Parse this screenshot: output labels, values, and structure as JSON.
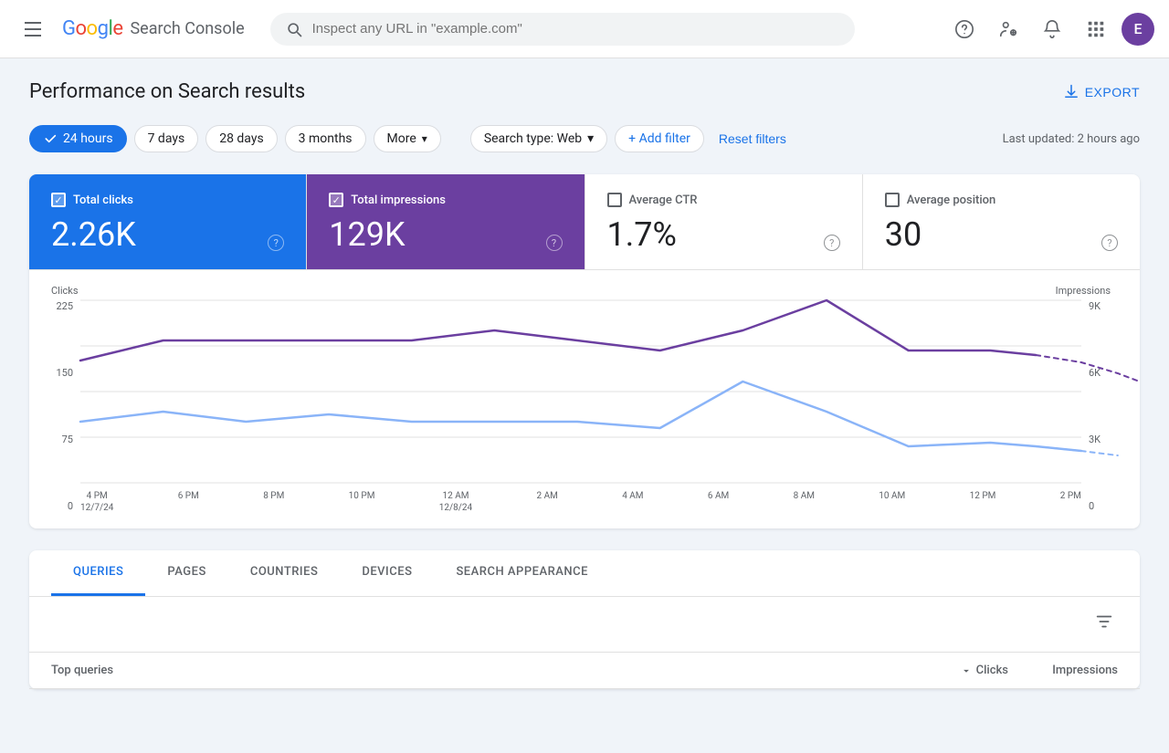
{
  "header": {
    "hamburger_label": "Menu",
    "logo_google": "Google",
    "logo_letters": [
      {
        "letter": "G",
        "color_class": "g-blue"
      },
      {
        "letter": "o",
        "color_class": "g-red"
      },
      {
        "letter": "o",
        "color_class": "g-yellow"
      },
      {
        "letter": "g",
        "color_class": "g-blue"
      },
      {
        "letter": "l",
        "color_class": "g-green"
      },
      {
        "letter": "e",
        "color_class": "g-red"
      }
    ],
    "product_name": "Search Console",
    "search_placeholder": "Inspect any URL in \"example.com\"",
    "help_icon_label": "?",
    "admin_icon_label": "Admin",
    "bell_icon_label": "Notifications",
    "grid_icon_label": "Apps",
    "avatar_initial": "E"
  },
  "page": {
    "title": "Performance on Search results",
    "export_label": "EXPORT"
  },
  "filters": {
    "chips": [
      {
        "label": "24 hours",
        "active": true
      },
      {
        "label": "7 days",
        "active": false
      },
      {
        "label": "28 days",
        "active": false
      },
      {
        "label": "3 months",
        "active": false
      },
      {
        "label": "More",
        "active": false,
        "has_chevron": true
      }
    ],
    "search_type_label": "Search type: Web",
    "add_filter_label": "+ Add filter",
    "reset_label": "Reset filters",
    "last_updated": "Last updated: 2 hours ago"
  },
  "metrics": [
    {
      "label": "Total clicks",
      "value": "2.26K",
      "active": true,
      "theme": "blue",
      "checked": true
    },
    {
      "label": "Total impressions",
      "value": "129K",
      "active": true,
      "theme": "purple",
      "checked": true
    },
    {
      "label": "Average CTR",
      "value": "1.7%",
      "active": false,
      "theme": "none",
      "checked": false
    },
    {
      "label": "Average position",
      "value": "30",
      "active": false,
      "theme": "none",
      "checked": false
    }
  ],
  "chart": {
    "y_label_left": "Clicks",
    "y_label_right": "Impressions",
    "y_ticks_left": [
      "225",
      "150",
      "75",
      "0"
    ],
    "y_ticks_right": [
      "9K",
      "6K",
      "3K",
      "0"
    ],
    "x_labels": [
      {
        "line1": "4 PM",
        "line2": "12/7/24"
      },
      {
        "line1": "6 PM",
        "line2": ""
      },
      {
        "line1": "8 PM",
        "line2": ""
      },
      {
        "line1": "10 PM",
        "line2": ""
      },
      {
        "line1": "12 AM",
        "line2": "12/8/24"
      },
      {
        "line1": "2 AM",
        "line2": ""
      },
      {
        "line1": "4 AM",
        "line2": ""
      },
      {
        "line1": "6 AM",
        "line2": ""
      },
      {
        "line1": "8 AM",
        "line2": ""
      },
      {
        "line1": "10 AM",
        "line2": ""
      },
      {
        "line1": "12 PM",
        "line2": ""
      },
      {
        "line1": "2 PM",
        "line2": ""
      }
    ],
    "clicks_line_color": "#8ab4f8",
    "impressions_line_color": "#6b3fa0"
  },
  "tabs": {
    "items": [
      {
        "label": "QUERIES",
        "active": true
      },
      {
        "label": "PAGES",
        "active": false
      },
      {
        "label": "COUNTRIES",
        "active": false
      },
      {
        "label": "DEVICES",
        "active": false
      },
      {
        "label": "SEARCH APPEARANCE",
        "active": false
      }
    ],
    "table_headers": {
      "query_col": "Top queries",
      "clicks_col": "Clicks",
      "impressions_col": "Impressions"
    }
  }
}
